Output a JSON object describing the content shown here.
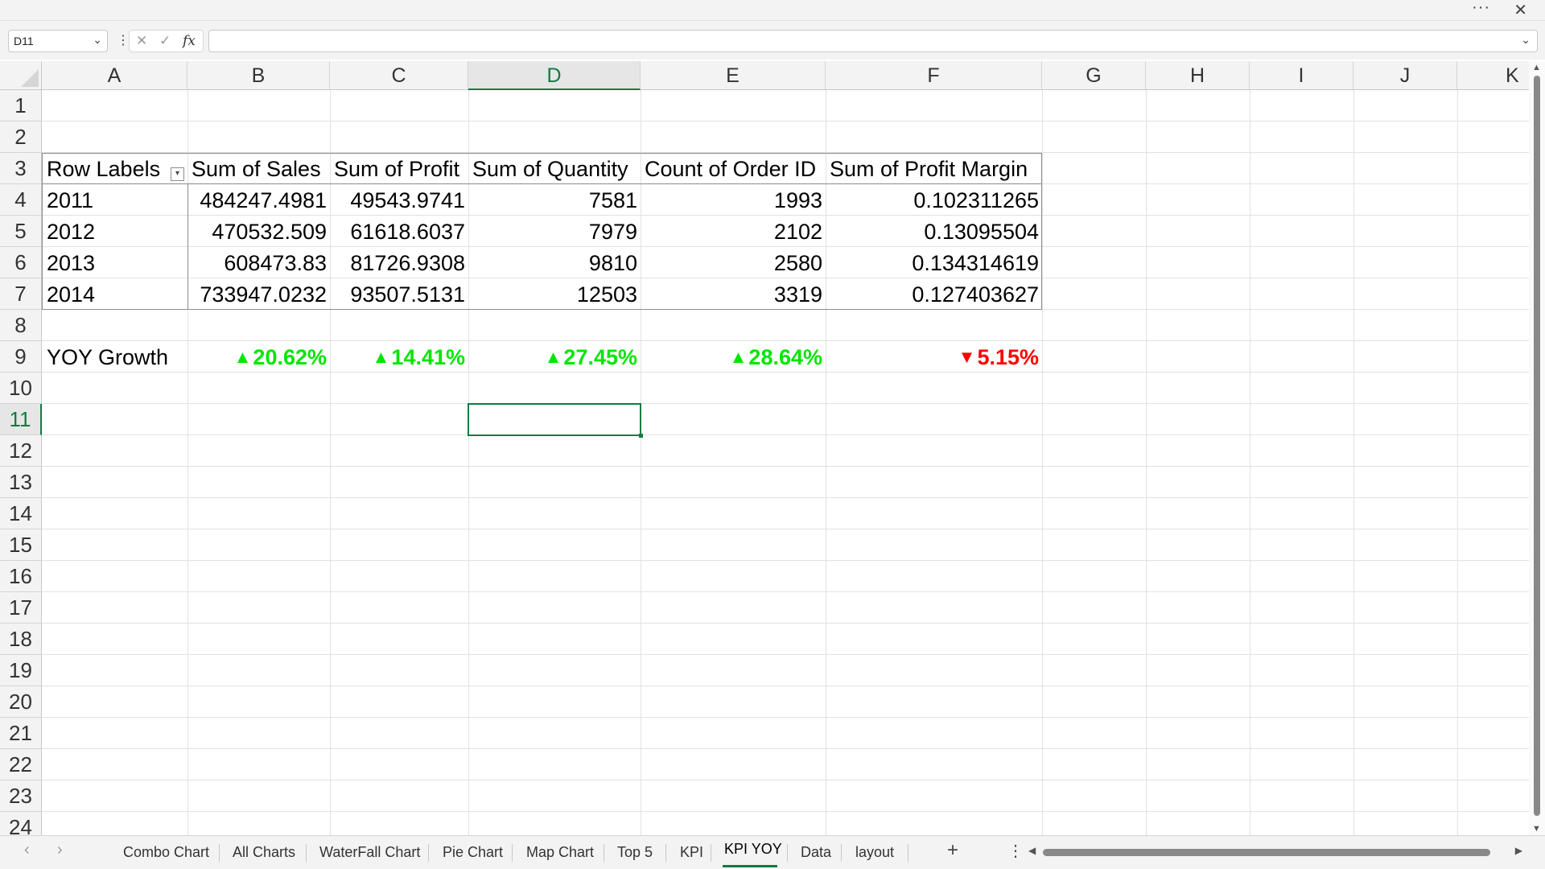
{
  "window": {
    "more_glyph": "···",
    "close_glyph": "✕"
  },
  "formula_bar": {
    "name_box": "D11",
    "dropdown_glyph": "⌄",
    "separator_glyph": "⋮",
    "cancel_glyph": "✕",
    "enter_glyph": "✓",
    "fx_label": "fx",
    "formula_value": ""
  },
  "columns": [
    "A",
    "B",
    "C",
    "D",
    "E",
    "F",
    "G",
    "H",
    "I",
    "J",
    "K"
  ],
  "selected_column": "D",
  "rows": [
    "1",
    "2",
    "3",
    "4",
    "5",
    "6",
    "7",
    "8",
    "9",
    "10",
    "11",
    "12",
    "13",
    "14",
    "15",
    "16",
    "17",
    "18",
    "19",
    "20",
    "21",
    "22",
    "23",
    "24"
  ],
  "selected_row": "11",
  "pivot": {
    "headers": [
      "Row Labels",
      "Sum of Sales",
      "Sum of Profit",
      "Sum of Quantity",
      "Count of Order ID",
      "Sum of Profit Margin"
    ],
    "filter_glyph": "▾",
    "data": [
      [
        "2011",
        "484247.4981",
        "49543.9741",
        "7581",
        "1993",
        "0.102311265"
      ],
      [
        "2012",
        "470532.509",
        "61618.6037",
        "7979",
        "2102",
        "0.13095504"
      ],
      [
        "2013",
        "608473.83",
        "81726.9308",
        "9810",
        "2580",
        "0.134314619"
      ],
      [
        "2014",
        "733947.0232",
        "93507.5131",
        "12503",
        "3319",
        "0.127403627"
      ]
    ]
  },
  "yoy": {
    "label": "YOY Growth",
    "values": [
      {
        "arrow": "▲",
        "text": "20.62%",
        "status": "up"
      },
      {
        "arrow": "▲",
        "text": "14.41%",
        "status": "up"
      },
      {
        "arrow": "▲",
        "text": "27.45%",
        "status": "up"
      },
      {
        "arrow": "▲",
        "text": "28.64%",
        "status": "up"
      },
      {
        "arrow": "▼",
        "text": "5.15%",
        "status": "down"
      }
    ]
  },
  "colors": {
    "accent": "#107c41",
    "up": "#00e600",
    "down": "#ff0000"
  },
  "sheet_tabs": {
    "prev_glyph": "‹",
    "next_glyph": "›",
    "tabs": [
      "Combo Chart",
      "All Charts",
      "WaterFall Chart",
      "Pie Chart",
      "Map Chart",
      "Top 5",
      "KPI",
      "KPI YOY",
      "Data",
      "layout"
    ],
    "active": "KPI YOY",
    "add_glyph": "+",
    "more_glyph": "⋮"
  },
  "scroll": {
    "up_glyph": "▲",
    "down_glyph": "▼",
    "left_glyph": "◀",
    "right_glyph": "▶"
  }
}
